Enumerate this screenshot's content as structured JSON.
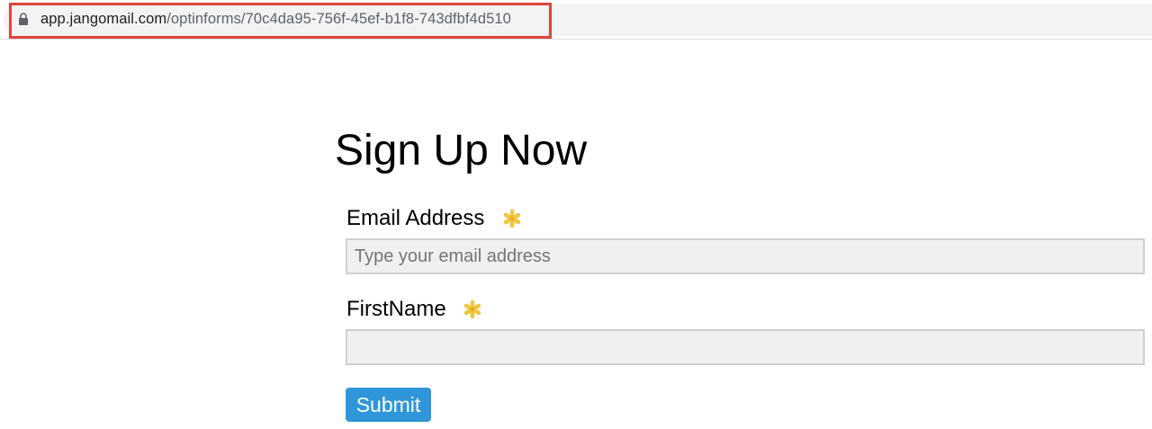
{
  "browser": {
    "url_domain": "app.jangomail.com",
    "url_path": "/optinforms/70c4da95-756f-45ef-b1f8-743dfbf4d510",
    "lock_icon": "lock-icon",
    "highlight_color": "#e0453a"
  },
  "form": {
    "title": "Sign Up Now",
    "fields": [
      {
        "label": "Email Address",
        "placeholder": "Type your email address",
        "value": "",
        "required_icon": "asterisk-icon"
      },
      {
        "label": "FirstName",
        "placeholder": "",
        "value": "",
        "required_icon": "asterisk-icon"
      }
    ],
    "submit_label": "Submit"
  },
  "colors": {
    "button": "#2f97d9",
    "required_icon": "#f2c541",
    "input_background": "#f0f0f0"
  }
}
